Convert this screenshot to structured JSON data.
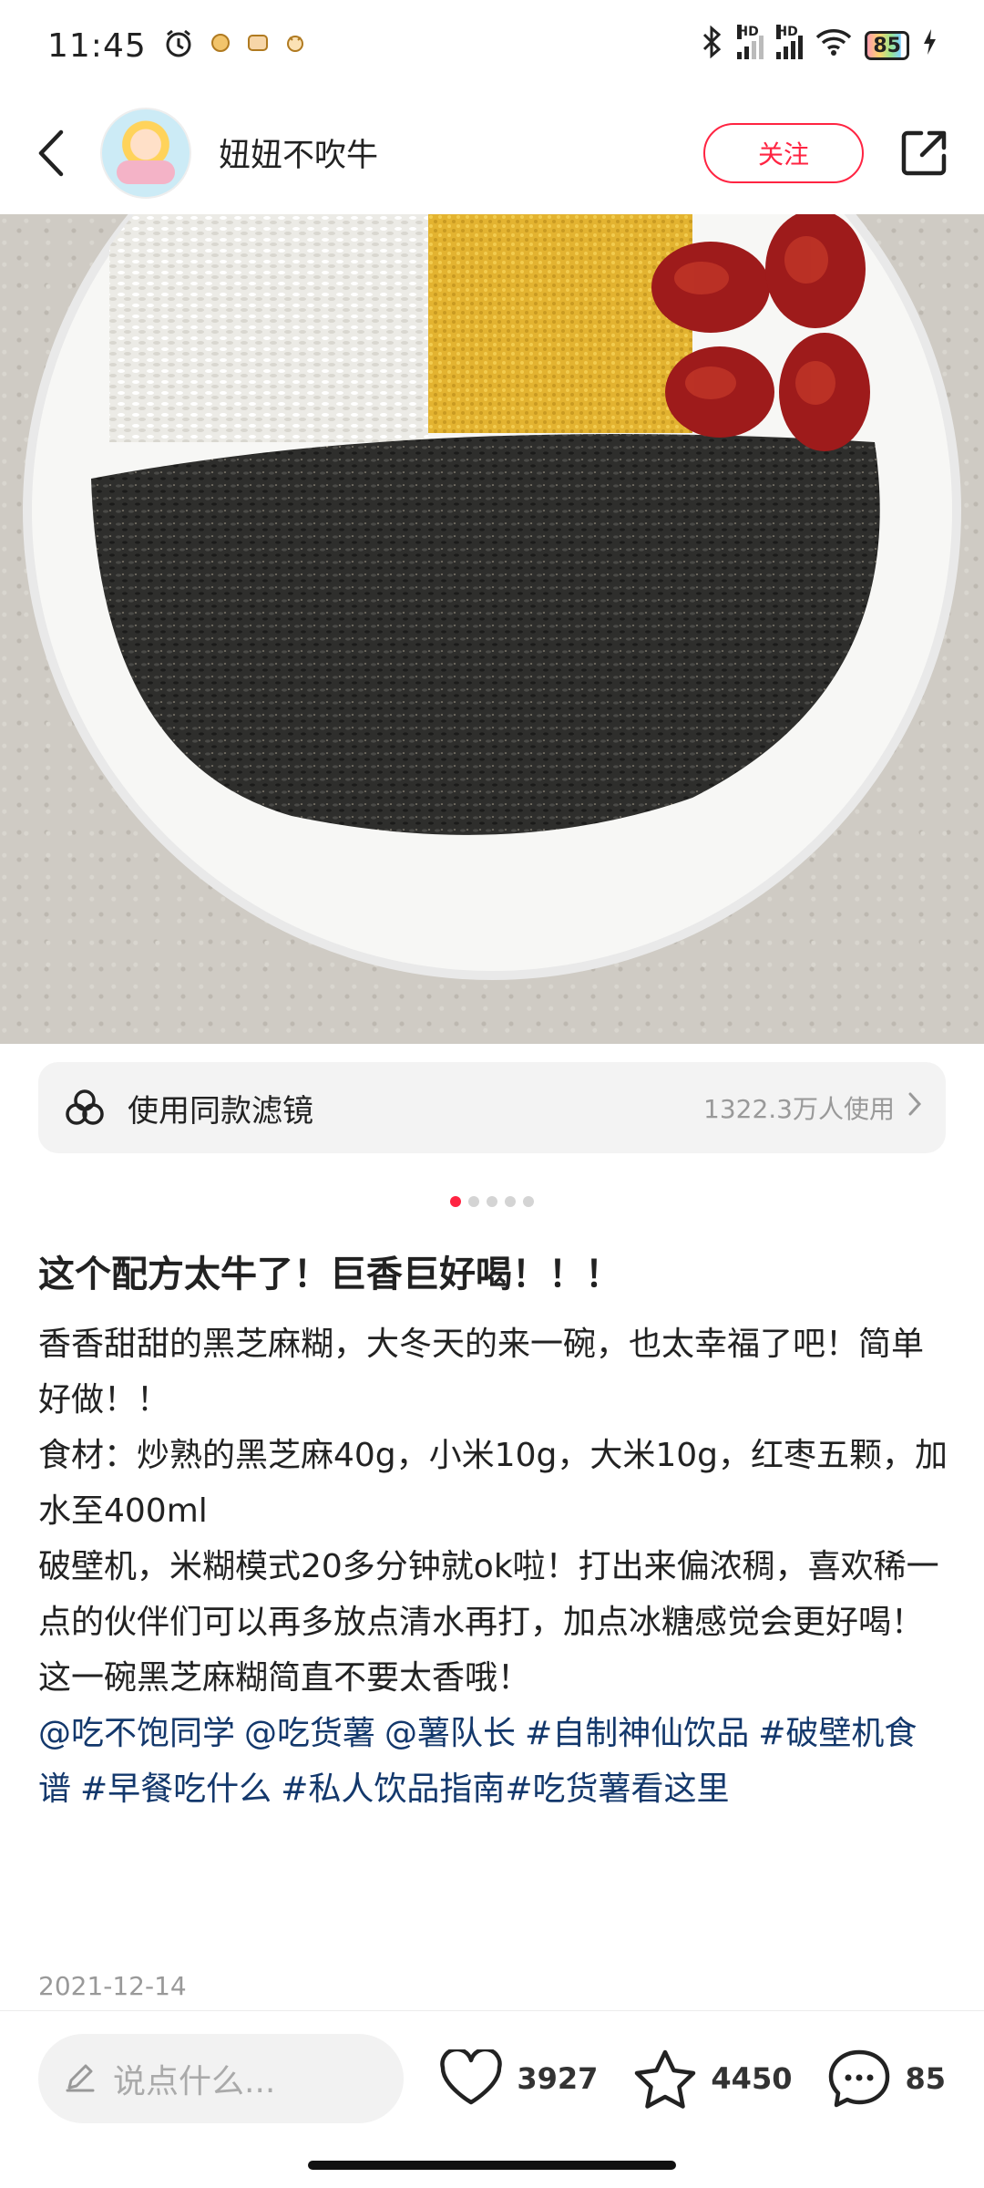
{
  "status_bar": {
    "time": "11:45",
    "battery": "85",
    "hd_label": "HD"
  },
  "header": {
    "author_name": "妞妞不吹牛",
    "follow_label": "关注"
  },
  "filter": {
    "label": "使用同款滤镜",
    "count": "1322.3万人使用"
  },
  "pager": {
    "total": 5,
    "current": 1
  },
  "post": {
    "title": "这个配方太牛了！巨香巨好喝！！！",
    "paragraphs": [
      "香香甜甜的黑芝麻糊，大冬天的来一碗，也太幸福了吧！简单好做！！",
      "食材：炒熟的黑芝麻40g，小米10g，大米10g，红枣五颗，加水至400ml",
      "破壁机，米糊模式20多分钟就ok啦！打出来偏浓稠，喜欢稀一点的伙伴们可以再多放点清水再打，加点冰糖感觉会更好喝！",
      "这一碗黑芝麻糊简直不要太香哦！"
    ],
    "tags": [
      "@吃不饱同学",
      "@吃货薯",
      "@薯队长",
      "#自制神仙饮品",
      "#破壁机食谱",
      "#早餐吃什么",
      "#私人饮品指南",
      "#吃货薯看这里"
    ],
    "date": "2021-12-14"
  },
  "bottom_bar": {
    "comment_placeholder": "说点什么...",
    "likes": "3927",
    "favorites": "4450",
    "comments": "85"
  },
  "colors": {
    "accent": "#ff2442",
    "tag": "#13386c",
    "muted": "#999999"
  }
}
